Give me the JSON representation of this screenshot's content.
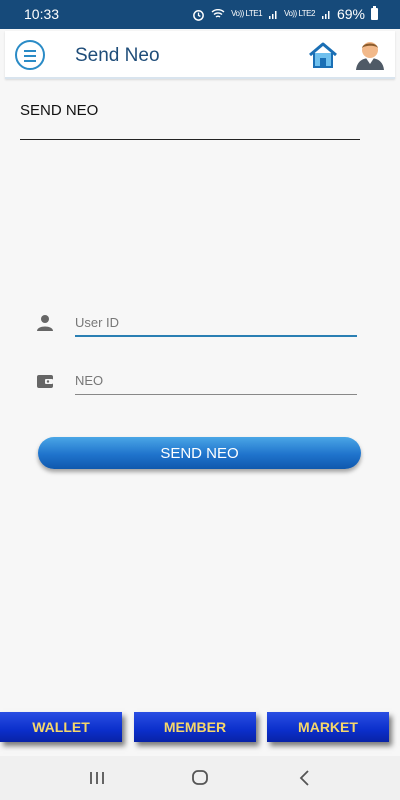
{
  "status": {
    "time": "10:33",
    "network_1": "Vo)) LTE1",
    "network_2": "Vo)) LTE2",
    "battery": "69%"
  },
  "appbar": {
    "title": "Send Neo",
    "icons": [
      "menu-icon",
      "home-icon",
      "user-profile-icon"
    ]
  },
  "form": {
    "section_title": "SEND NEO",
    "user_id_placeholder": "User ID",
    "neo_placeholder": "NEO",
    "user_id_value": "",
    "neo_value": "",
    "submit_label": "SEND NEO"
  },
  "bottom_tabs": [
    {
      "label": "WALLET"
    },
    {
      "label": "MEMBER"
    },
    {
      "label": "MARKET"
    }
  ],
  "colors": {
    "status_bar": "#164a7a",
    "accent": "#2a8bc6",
    "button": "#1f73cc",
    "tab_bg": "#0b2fcb",
    "tab_text": "#f6d76a"
  }
}
